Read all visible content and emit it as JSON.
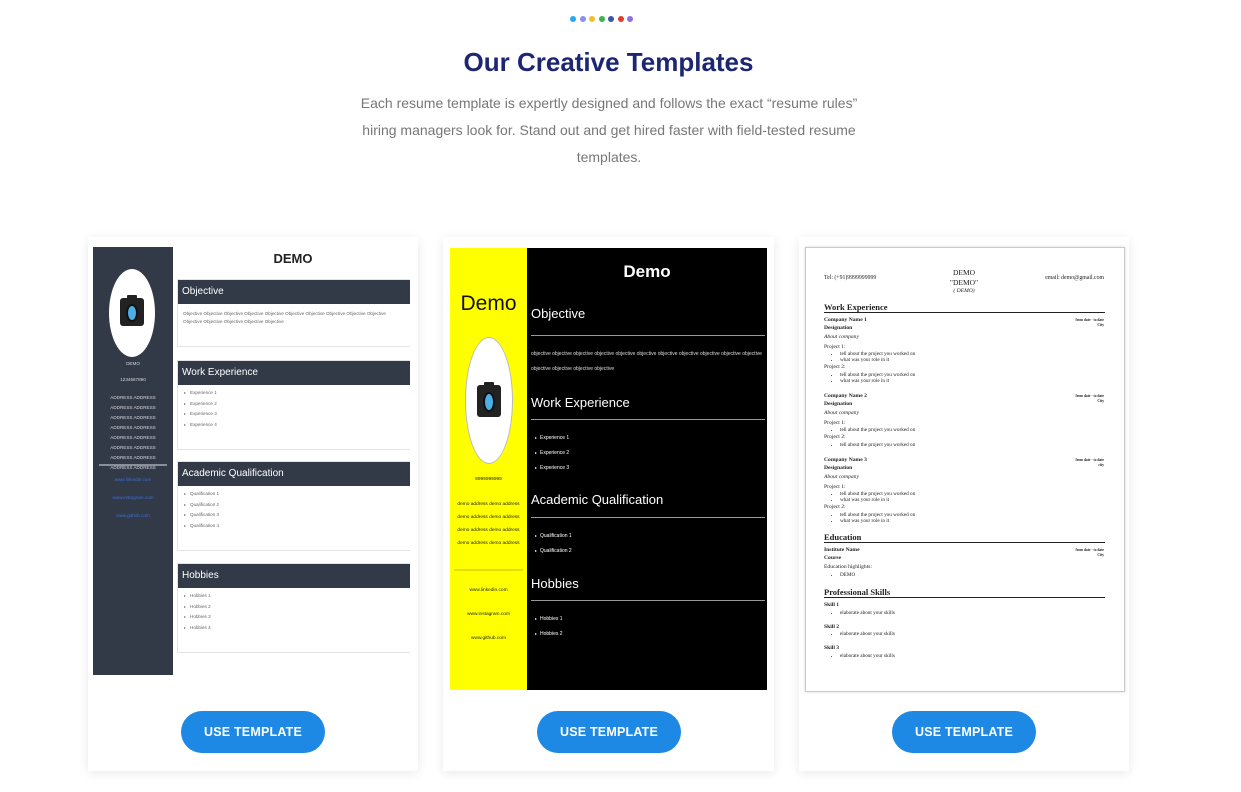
{
  "header": {
    "dot_colors": [
      "#2aa7f2",
      "#8a8ef5",
      "#f5bd2a",
      "#3fb14b",
      "#3d55a8",
      "#e03b30",
      "#8d6fe0"
    ],
    "title": "Our Creative Templates",
    "subtitle": "Each resume template is expertly designed and follows the exact “resume rules” hiring managers look for. Stand out and get hired faster with field-tested resume templates."
  },
  "button_color": "#1e88e5",
  "templates": [
    {
      "button_label": "USE TEMPLATE",
      "preview": {
        "name": "DEMO",
        "side_name": "DEMO",
        "phone": "1234567890",
        "address": "ADDRESS ADDRESS ADDRESS ADDRESS ADDRESS ADDRESS ADDRESS ADDRESS ADDRESS ADDRESS ADDRESS ADDRESS ADDRESS ADDRESS ADDRESS ADDRESS",
        "links": [
          "www.linkedin.com",
          "www.instagram.com",
          "www.github.com"
        ],
        "sections": [
          {
            "title": "Objective",
            "text": "Objective Objective Objective Objective Objective Objective Objective Objective Objective Objective Objective Objective Objective Objective Objective"
          },
          {
            "title": "Work Experience",
            "items": [
              "Experience 1",
              "Experience 2",
              "Experience 3",
              "Experience 4"
            ]
          },
          {
            "title": "Academic Qualification",
            "items": [
              "Qualification 1",
              "Qualification 2",
              "Qualification 3",
              "Qualification 4"
            ]
          },
          {
            "title": "Hobbies",
            "items": [
              "Hobbies 1",
              "Hobbies 2",
              "Hobbies 3",
              "Hobbies 4"
            ]
          }
        ]
      }
    },
    {
      "button_label": "USE TEMPLATE",
      "preview": {
        "side_name": "Demo",
        "name": "Demo",
        "phone": "9999999999",
        "address": "demo address demo address demo address demo address demo address demo address demo address demo address",
        "links": [
          "www.linkedin.com",
          "www.instagram.com",
          "www.github.com"
        ],
        "objective_title": "Objective",
        "objective_text": "objective objective objective objective objective objective objective objective objective objective objective objective objective objective objective",
        "work_title": "Work Experience",
        "work_items": [
          "Experience 1",
          "Experience 2",
          "Experience 3"
        ],
        "academic_title": "Academic Qualification",
        "academic_items": [
          "Qualification 1",
          "Qualification 2"
        ],
        "hobbies_title": "Hobbies",
        "hobbies_items": [
          "Hobbies 1",
          "Hobbies 2"
        ]
      }
    },
    {
      "button_label": "USE TEMPLATE",
      "preview": {
        "tel": "Tel: (+91)9999999999",
        "name": "DEMO",
        "name_quoted": "\"DEMO\"",
        "name_sub": "( DEMO)",
        "email": "email: demo@gmail.com",
        "work_title": "Work Experience",
        "companies": [
          {
            "name": "Company Name 1",
            "date": "from date - to date",
            "city": "City",
            "designation": "Designation",
            "about": "About company"
          },
          {
            "name": "Company Name 2",
            "date": "from date - to date",
            "city": "City",
            "designation": "Designation",
            "about": "About company"
          },
          {
            "name": "Company Name 3",
            "date": "from date - to date",
            "city": "city",
            "designation": "Designation",
            "about": "About company"
          }
        ],
        "project1": "Project 1:",
        "project2": "Project 2:",
        "bullet_a": "tell about the project you worked on",
        "bullet_b": "what was your role in it",
        "education_title": "Education",
        "institute": "Institute Name",
        "course": "Course",
        "edu_date": "from date - to date",
        "edu_city": "City",
        "edu_highlights": "Education highlights:",
        "edu_item": "DEMO",
        "skills_title": "Professional Skills",
        "skills": [
          {
            "name": "Skill 1",
            "desc": "elaborate about your skills"
          },
          {
            "name": "Skill 2",
            "desc": "elaborate about your skills"
          },
          {
            "name": "Skill 3",
            "desc": "elaborate about your skills"
          }
        ]
      }
    }
  ]
}
